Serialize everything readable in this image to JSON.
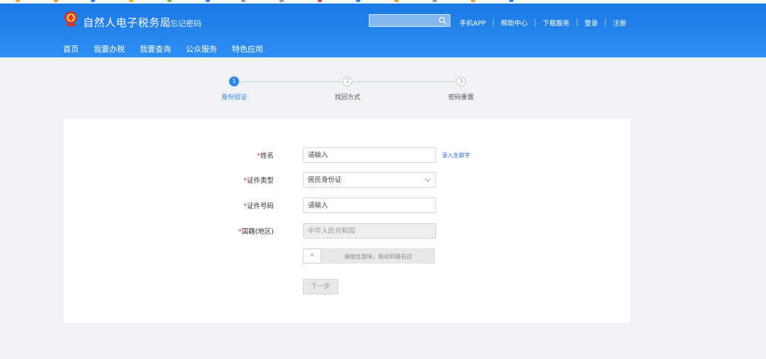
{
  "header": {
    "site_title": "自然人电子税务局",
    "page_subtitle": "忘记密码",
    "search_placeholder": "",
    "links": [
      "手机APP",
      "帮助中心",
      "下载服务",
      "登录",
      "注册"
    ]
  },
  "nav": {
    "items": [
      "首页",
      "我要办税",
      "我要查询",
      "公众服务",
      "特色应用"
    ]
  },
  "steps": [
    {
      "number": "1",
      "label": "身份验证"
    },
    {
      "number": "2",
      "label": "找回方式"
    },
    {
      "number": "3",
      "label": "密码重置"
    }
  ],
  "form": {
    "name_label": "姓名",
    "name_placeholder": "请输入",
    "rare_char_link": "录入生僻字",
    "id_type_label": "证件类型",
    "id_type_value": "居民身份证",
    "id_number_label": "证件号码",
    "id_number_placeholder": "请输入",
    "nationality_label": "国籍(地区)",
    "nationality_value": "中华人民共和国",
    "required_mark": "*",
    "slider_handle": "»",
    "slider_text": "请按住滑块，拖动到最右边",
    "next_button": "下一步"
  },
  "colors": {
    "header_blue": "#1a78e4",
    "accent": "#2b86ef",
    "required": "#e63c3c"
  }
}
